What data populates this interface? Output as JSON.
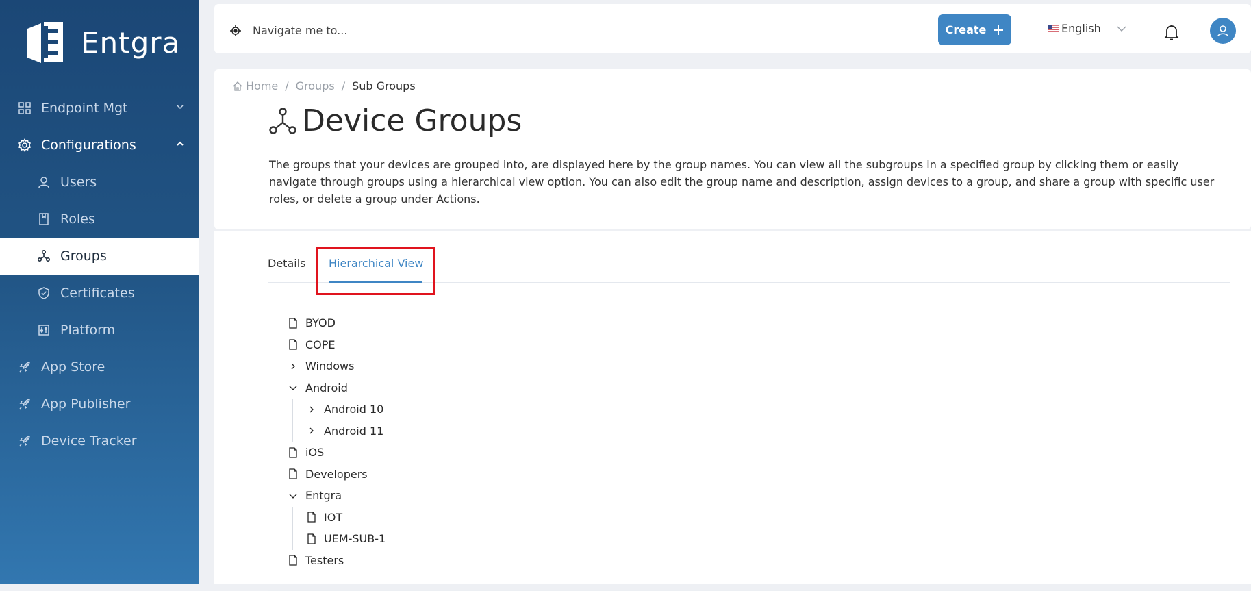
{
  "brand": {
    "name": "Entgra"
  },
  "sidebar": {
    "items": [
      {
        "label": "Endpoint Mgt",
        "icon": "grid-icon"
      },
      {
        "label": "Configurations",
        "icon": "gear-icon"
      },
      {
        "label": "Users",
        "icon": "user-icon"
      },
      {
        "label": "Roles",
        "icon": "book-icon"
      },
      {
        "label": "Groups",
        "icon": "group-icon"
      },
      {
        "label": "Certificates",
        "icon": "shield-icon"
      },
      {
        "label": "Platform",
        "icon": "platform-icon"
      },
      {
        "label": "App Store",
        "icon": "rocket-icon"
      },
      {
        "label": "App Publisher",
        "icon": "rocket-icon"
      },
      {
        "label": "Device Tracker",
        "icon": "rocket-icon"
      }
    ]
  },
  "topbar": {
    "search_placeholder": "Navigate me to...",
    "create_label": "Create",
    "language": "English"
  },
  "breadcrumb": {
    "home": "Home",
    "groups": "Groups",
    "current": "Sub Groups",
    "separator": "/"
  },
  "page": {
    "title": "Device Groups",
    "description": "The groups that your devices are grouped into, are displayed here by the group names. You can view all the subgroups in a specified group by clicking them or easily navigate through groups using a hierarchical view option. You can also edit the group name and description, assign devices to a group, and share a group with specific user roles, or delete a group under Actions."
  },
  "tabs": {
    "details": "Details",
    "hierarchical": "Hierarchical View"
  },
  "tree": [
    {
      "label": "BYOD"
    },
    {
      "label": "COPE"
    },
    {
      "label": "Windows"
    },
    {
      "label": "Android"
    },
    {
      "label": "Android 10"
    },
    {
      "label": "Android 11"
    },
    {
      "label": "iOS"
    },
    {
      "label": "Developers"
    },
    {
      "label": "Entgra"
    },
    {
      "label": "IOT"
    },
    {
      "label": "UEM-SUB-1"
    },
    {
      "label": "Testers"
    }
  ],
  "colors": {
    "accent": "#3f86c4",
    "sidebar": "#1b4776",
    "highlight": "#e0141e"
  }
}
